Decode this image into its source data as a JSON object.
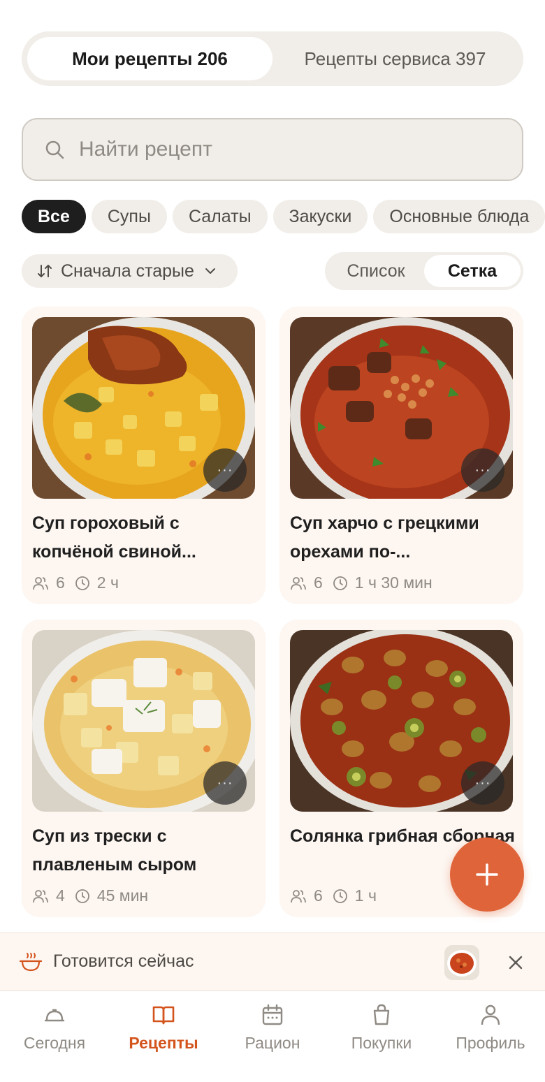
{
  "top_tabs": {
    "my_recipes": "Мои рецепты 206",
    "service_recipes": "Рецепты сервиса 397"
  },
  "search": {
    "placeholder": "Найти рецепт"
  },
  "categories": [
    "Все",
    "Супы",
    "Салаты",
    "Закуски",
    "Основные блюда"
  ],
  "sort": {
    "label": "Сначала старые"
  },
  "view_toggle": {
    "list": "Список",
    "grid": "Сетка",
    "selected": "Сетка"
  },
  "recipes": [
    {
      "title": "Суп гороховый с копчёной свиной...",
      "servings": "6",
      "time": "2 ч"
    },
    {
      "title": "Суп харчо с грецкими орехами по-...",
      "servings": "6",
      "time": "1 ч 30 мин"
    },
    {
      "title": "Суп из трески с плавленым сыром",
      "servings": "4",
      "time": "45 мин"
    },
    {
      "title": "Солянка грибная сборная",
      "servings": "6",
      "time": "1 ч"
    }
  ],
  "more_label": "···",
  "cooking_now": {
    "label": "Готовится сейчас"
  },
  "bottom_nav": {
    "today": "Сегодня",
    "recipes": "Рецепты",
    "diet": "Рацион",
    "shopping": "Покупки",
    "profile": "Профиль",
    "active": "Рецепты"
  },
  "colors": {
    "accent": "#e0643a",
    "nav_active": "#d4541e",
    "chip_bg": "#f1eee9",
    "card_bg": "#fdf6f1",
    "chip_active_bg": "#1e1e1e"
  }
}
